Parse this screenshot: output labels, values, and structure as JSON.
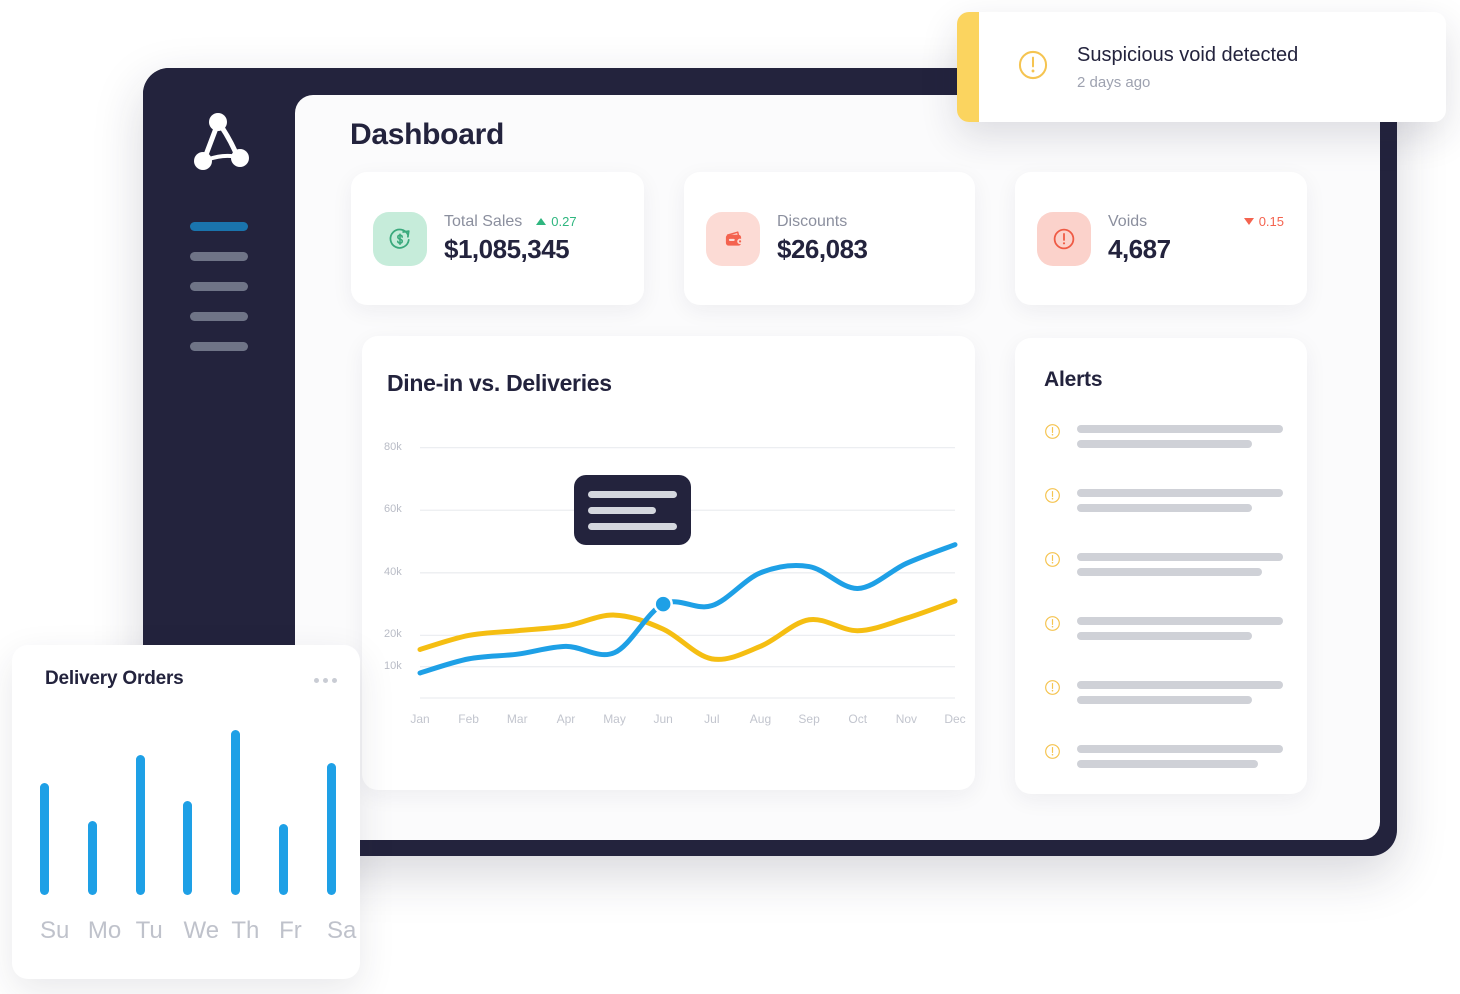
{
  "app": {
    "logo_icon": "node-graph-logo-icon",
    "nav": [
      {
        "id": "nav-item-1",
        "active": true
      },
      {
        "id": "nav-item-2",
        "active": false
      },
      {
        "id": "nav-item-3",
        "active": false
      },
      {
        "id": "nav-item-4",
        "active": false
      },
      {
        "id": "nav-item-5",
        "active": false
      }
    ]
  },
  "header": {
    "title": "Dashboard"
  },
  "stats": [
    {
      "label": "Total Sales",
      "value": "$1,085,345",
      "delta": "0.27",
      "delta_direction": "up",
      "delta_color": "#2fb67f",
      "icon": "sales-growth-icon",
      "icon_bg": "#c6ecda",
      "icon_color": "#3aa97c"
    },
    {
      "label": "Discounts",
      "value": "$26,083",
      "delta": "",
      "delta_direction": "none",
      "delta_color": "#f4634f",
      "icon": "wallet-icon",
      "icon_bg": "#fcdbd5",
      "icon_color": "#f4634f"
    },
    {
      "label": "Voids",
      "value": "4,687",
      "delta": "0.15",
      "delta_direction": "down",
      "delta_color": "#f4634f",
      "icon": "alert-circle-icon",
      "icon_bg": "#fbd2cb",
      "icon_color": "#ef5a44"
    }
  ],
  "chart_card": {
    "title": "Dine-in vs. Deliveries",
    "tooltip": {
      "icon": "tooltip-placeholder",
      "lines": 3
    }
  },
  "chart_data": {
    "type": "line",
    "title": "Dine-in vs. Deliveries",
    "xlabel": "",
    "ylabel": "",
    "grid": true,
    "legend_position": "none",
    "categories": [
      "Jan",
      "Feb",
      "Mar",
      "Apr",
      "May",
      "Jun",
      "Jul",
      "Aug",
      "Sep",
      "Oct",
      "Nov",
      "Dec"
    ],
    "ytick_labels": [
      "80k",
      "60k",
      "40k",
      "20k",
      "10k"
    ],
    "ytick_values": [
      80000,
      60000,
      40000,
      20000,
      10000
    ],
    "ylim": [
      0,
      80000
    ],
    "highlight_point": {
      "series": "Deliveries",
      "x": "Jun",
      "y": 30000
    },
    "series": [
      {
        "name": "Deliveries",
        "color": "#1ea0e6",
        "values": [
          8000,
          12500,
          14000,
          16500,
          14500,
          30000,
          29500,
          40000,
          42000,
          35000,
          43000,
          49000
        ]
      },
      {
        "name": "Dine-in",
        "color": "#f5be12",
        "values": [
          15500,
          20000,
          21500,
          23000,
          26500,
          22000,
          12500,
          16500,
          25000,
          21500,
          25500,
          31000
        ]
      }
    ]
  },
  "alerts_card": {
    "title": "Alerts",
    "items": [
      {
        "icon": "alert-circle-icon",
        "line1_width": "100%",
        "line2_width": "85%"
      },
      {
        "icon": "alert-circle-icon",
        "line1_width": "100%",
        "line2_width": "85%"
      },
      {
        "icon": "alert-circle-icon",
        "line1_width": "100%",
        "line2_width": "90%"
      },
      {
        "icon": "alert-circle-icon",
        "line1_width": "100%",
        "line2_width": "85%"
      },
      {
        "icon": "alert-circle-icon",
        "line1_width": "100%",
        "line2_width": "85%"
      },
      {
        "icon": "alert-circle-icon",
        "line1_width": "100%",
        "line2_width": "88%"
      }
    ]
  },
  "toast": {
    "title": "Suspicious void detected",
    "time": "2 days ago",
    "icon": "alert-circle-icon",
    "accent_color": "#fbd45f"
  },
  "delivery_card": {
    "title": "Delivery Orders",
    "menu_icon": "kebab-menu-icon"
  },
  "delivery_chart": {
    "type": "bar",
    "title": "Delivery Orders",
    "categories": [
      "Su",
      "Mo",
      "Tu",
      "We",
      "Th",
      "Fr",
      "Sa"
    ],
    "values": [
      68,
      45,
      85,
      57,
      100,
      43,
      80
    ],
    "bar_color": "#1ea0e6",
    "ylim": [
      0,
      100
    ]
  }
}
